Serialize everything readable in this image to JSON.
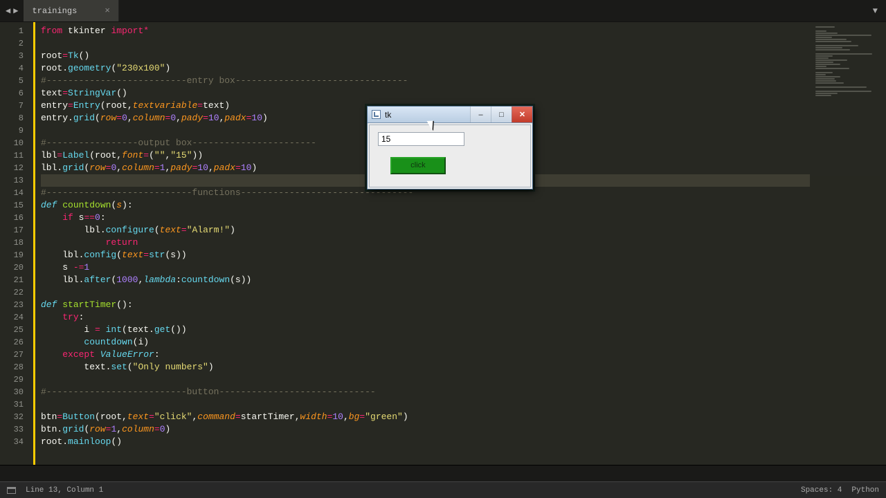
{
  "tab": {
    "title": "trainings"
  },
  "status": {
    "position": "Line 13, Column 1",
    "spaces": "Spaces: 4",
    "lang": "Python"
  },
  "tk": {
    "title": "tk",
    "entry_value": "15",
    "button_label": "click"
  },
  "code_lines": [
    [
      [
        "red",
        "from "
      ],
      [
        "def",
        "tkinter "
      ],
      [
        "red",
        "import"
      ],
      [
        "red",
        "*"
      ]
    ],
    [],
    [
      [
        "def",
        "root"
      ],
      [
        "red",
        "="
      ],
      [
        "blue-n",
        "Tk"
      ],
      [
        "def",
        "()"
      ]
    ],
    [
      [
        "def",
        "root."
      ],
      [
        "blue-n",
        "geometry"
      ],
      [
        "def",
        "("
      ],
      [
        "str",
        "\"230x100\""
      ],
      [
        "def",
        ")"
      ]
    ],
    [
      [
        "cmt",
        "#--------------------------entry box--------------------------------"
      ]
    ],
    [
      [
        "def",
        "text"
      ],
      [
        "red",
        "="
      ],
      [
        "blue-n",
        "StringVar"
      ],
      [
        "def",
        "()"
      ]
    ],
    [
      [
        "def",
        "entry"
      ],
      [
        "red",
        "="
      ],
      [
        "blue-n",
        "Entry"
      ],
      [
        "def",
        "(root,"
      ],
      [
        "arg",
        "textvariable"
      ],
      [
        "red",
        "="
      ],
      [
        "def",
        "text)"
      ]
    ],
    [
      [
        "def",
        "entry."
      ],
      [
        "blue-n",
        "grid"
      ],
      [
        "def",
        "("
      ],
      [
        "arg",
        "row"
      ],
      [
        "red",
        "="
      ],
      [
        "num",
        "0"
      ],
      [
        "def",
        ","
      ],
      [
        "arg",
        "column"
      ],
      [
        "red",
        "="
      ],
      [
        "num",
        "0"
      ],
      [
        "def",
        ","
      ],
      [
        "arg",
        "pady"
      ],
      [
        "red",
        "="
      ],
      [
        "num",
        "10"
      ],
      [
        "def",
        ","
      ],
      [
        "arg",
        "padx"
      ],
      [
        "red",
        "="
      ],
      [
        "num",
        "10"
      ],
      [
        "def",
        ")"
      ]
    ],
    [],
    [
      [
        "cmt",
        "#-----------------output box-----------------------"
      ]
    ],
    [
      [
        "def",
        "lbl"
      ],
      [
        "red",
        "="
      ],
      [
        "blue-n",
        "Label"
      ],
      [
        "def",
        "(root,"
      ],
      [
        "arg",
        "font"
      ],
      [
        "red",
        "="
      ],
      [
        "def",
        "("
      ],
      [
        "str",
        "\"\""
      ],
      [
        "def",
        ","
      ],
      [
        "str",
        "\"15\""
      ],
      [
        "def",
        "))"
      ]
    ],
    [
      [
        "def",
        "lbl."
      ],
      [
        "blue-n",
        "grid"
      ],
      [
        "def",
        "("
      ],
      [
        "arg",
        "row"
      ],
      [
        "red",
        "="
      ],
      [
        "num",
        "0"
      ],
      [
        "def",
        ","
      ],
      [
        "arg",
        "column"
      ],
      [
        "red",
        "="
      ],
      [
        "num",
        "1"
      ],
      [
        "def",
        ","
      ],
      [
        "arg",
        "pady"
      ],
      [
        "red",
        "="
      ],
      [
        "num",
        "10"
      ],
      [
        "def",
        ","
      ],
      [
        "arg",
        "padx"
      ],
      [
        "red",
        "="
      ],
      [
        "num",
        "10"
      ],
      [
        "def",
        ")"
      ]
    ],
    [],
    [
      [
        "cmt",
        "#---------------------------functions--------------------------------"
      ]
    ],
    [
      [
        "blue",
        "def "
      ],
      [
        "fn",
        "countdown"
      ],
      [
        "def",
        "("
      ],
      [
        "arg",
        "s"
      ],
      [
        "def",
        "):"
      ]
    ],
    [
      [
        "def",
        "    "
      ],
      [
        "red",
        "if "
      ],
      [
        "def",
        "s"
      ],
      [
        "red",
        "=="
      ],
      [
        "num",
        "0"
      ],
      [
        "def",
        ":"
      ]
    ],
    [
      [
        "def",
        "        lbl."
      ],
      [
        "blue-n",
        "configure"
      ],
      [
        "def",
        "("
      ],
      [
        "arg",
        "text"
      ],
      [
        "red",
        "="
      ],
      [
        "str",
        "\"Alarm!\""
      ],
      [
        "def",
        ")"
      ]
    ],
    [
      [
        "def",
        "            "
      ],
      [
        "red",
        "return"
      ]
    ],
    [
      [
        "def",
        "    lbl."
      ],
      [
        "blue-n",
        "config"
      ],
      [
        "def",
        "("
      ],
      [
        "arg",
        "text"
      ],
      [
        "red",
        "="
      ],
      [
        "blue-n",
        "str"
      ],
      [
        "def",
        "(s))"
      ]
    ],
    [
      [
        "def",
        "    s "
      ],
      [
        "red",
        "-="
      ],
      [
        "num",
        "1"
      ]
    ],
    [
      [
        "def",
        "    lbl."
      ],
      [
        "blue-n",
        "after"
      ],
      [
        "def",
        "("
      ],
      [
        "num",
        "1000"
      ],
      [
        "def",
        ","
      ],
      [
        "blue",
        "lambda"
      ],
      [
        "def",
        ":"
      ],
      [
        "blue-n",
        "countdown"
      ],
      [
        "def",
        "(s))"
      ]
    ],
    [],
    [
      [
        "blue",
        "def "
      ],
      [
        "fn",
        "startTimer"
      ],
      [
        "def",
        "():"
      ]
    ],
    [
      [
        "def",
        "    "
      ],
      [
        "red",
        "try"
      ],
      [
        "def",
        ":"
      ]
    ],
    [
      [
        "def",
        "        i "
      ],
      [
        "red",
        "= "
      ],
      [
        "blue-n",
        "int"
      ],
      [
        "def",
        "(text."
      ],
      [
        "blue-n",
        "get"
      ],
      [
        "def",
        "())"
      ]
    ],
    [
      [
        "def",
        "        "
      ],
      [
        "blue-n",
        "countdown"
      ],
      [
        "def",
        "(i)"
      ]
    ],
    [
      [
        "def",
        "    "
      ],
      [
        "red",
        "except "
      ],
      [
        "blue",
        "ValueError"
      ],
      [
        "def",
        ":"
      ]
    ],
    [
      [
        "def",
        "        text."
      ],
      [
        "blue-n",
        "set"
      ],
      [
        "def",
        "("
      ],
      [
        "str",
        "\"Only numbers\""
      ],
      [
        "def",
        ")"
      ]
    ],
    [],
    [
      [
        "cmt",
        "#--------------------------button-----------------------------"
      ]
    ],
    [],
    [
      [
        "def",
        "btn"
      ],
      [
        "red",
        "="
      ],
      [
        "blue-n",
        "Button"
      ],
      [
        "def",
        "(root,"
      ],
      [
        "arg",
        "text"
      ],
      [
        "red",
        "="
      ],
      [
        "str",
        "\"click\""
      ],
      [
        "def",
        ","
      ],
      [
        "arg",
        "command"
      ],
      [
        "red",
        "="
      ],
      [
        "def",
        "startTimer,"
      ],
      [
        "arg",
        "width"
      ],
      [
        "red",
        "="
      ],
      [
        "num",
        "10"
      ],
      [
        "def",
        ","
      ],
      [
        "arg",
        "bg"
      ],
      [
        "red",
        "="
      ],
      [
        "str",
        "\"green\""
      ],
      [
        "def",
        ")"
      ]
    ],
    [
      [
        "def",
        "btn."
      ],
      [
        "blue-n",
        "grid"
      ],
      [
        "def",
        "("
      ],
      [
        "arg",
        "row"
      ],
      [
        "red",
        "="
      ],
      [
        "num",
        "1"
      ],
      [
        "def",
        ","
      ],
      [
        "arg",
        "column"
      ],
      [
        "red",
        "="
      ],
      [
        "num",
        "0"
      ],
      [
        "def",
        ")"
      ]
    ],
    [
      [
        "def",
        "root."
      ],
      [
        "blue-n",
        "mainloop"
      ],
      [
        "def",
        "()"
      ]
    ]
  ],
  "current_line_index": 12
}
